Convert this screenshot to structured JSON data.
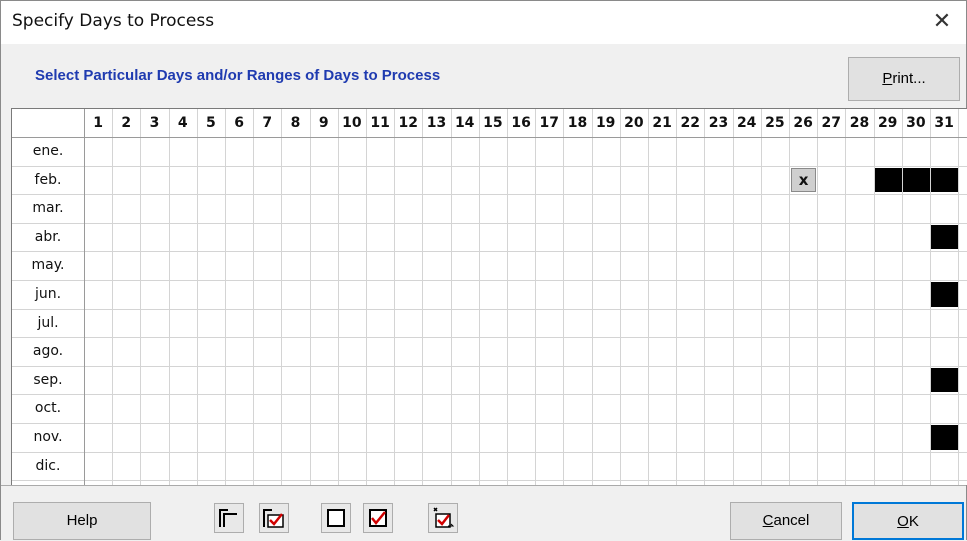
{
  "window": {
    "title": "Specify Days to Process",
    "close_glyph": "✕"
  },
  "subtitle": "Select Particular Days and/or Ranges of Days to Process",
  "buttons": {
    "print_pre": "",
    "print_key": "P",
    "print_post": "rint...",
    "help": "Help",
    "cancel_key": "C",
    "cancel_post": "ancel",
    "ok_key": "O",
    "ok_post": "K"
  },
  "icons": [
    "select-range-icon",
    "check-range-icon",
    "uncheck-icon",
    "check-icon",
    "toggle-selection-icon"
  ],
  "days": [
    "1",
    "2",
    "3",
    "4",
    "5",
    "6",
    "7",
    "8",
    "9",
    "10",
    "11",
    "12",
    "13",
    "14",
    "15",
    "16",
    "17",
    "18",
    "19",
    "20",
    "21",
    "22",
    "23",
    "24",
    "25",
    "26",
    "27",
    "28",
    "29",
    "30",
    "31"
  ],
  "months": [
    "ene.",
    "feb.",
    "mar.",
    "abr.",
    "may.",
    "jun.",
    "jul.",
    "ago.",
    "sep.",
    "oct.",
    "nov.",
    "dic."
  ],
  "filled_cells": [
    {
      "month": 1,
      "day": 29
    },
    {
      "month": 1,
      "day": 30
    },
    {
      "month": 1,
      "day": 31
    },
    {
      "month": 3,
      "day": 31
    },
    {
      "month": 5,
      "day": 31
    },
    {
      "month": 8,
      "day": 31
    },
    {
      "month": 10,
      "day": 31
    }
  ],
  "marked_cells": [
    {
      "month": 1,
      "day": 26,
      "mark": "x"
    }
  ]
}
